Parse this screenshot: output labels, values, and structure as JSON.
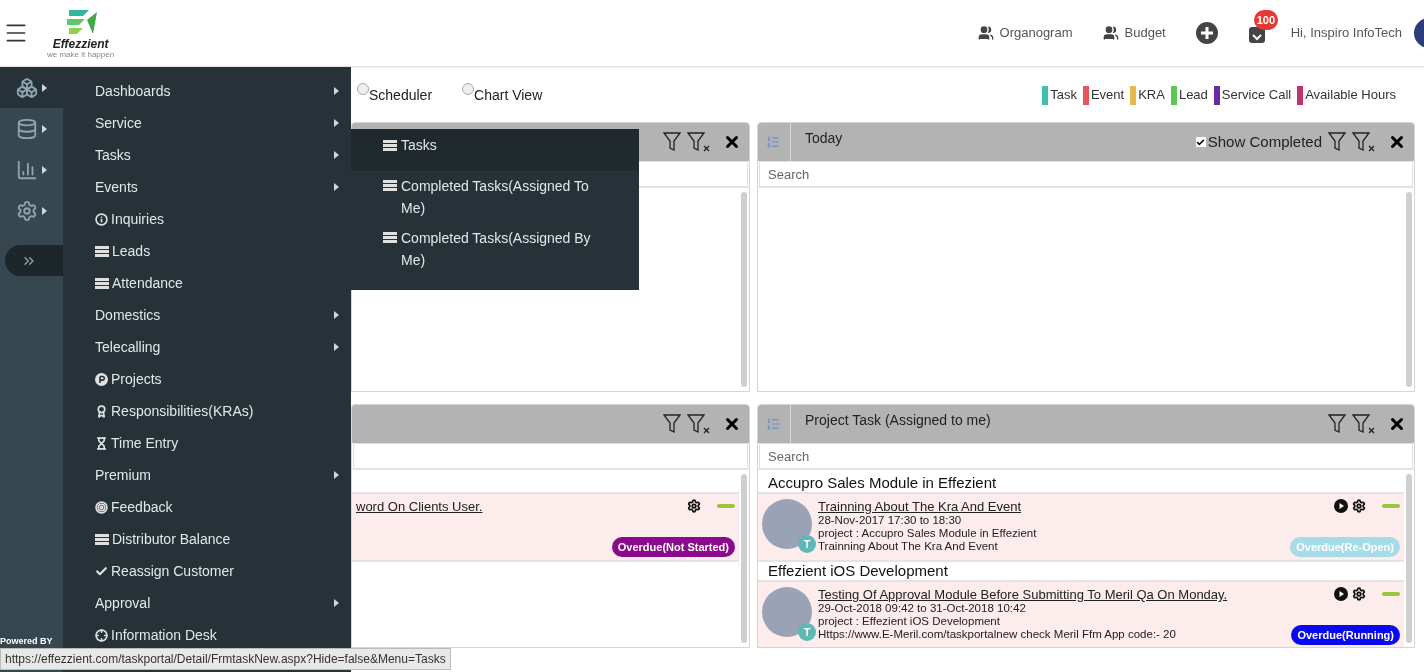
{
  "header": {
    "logo": {
      "name": "Effezzient",
      "tagline": "we make it happen"
    },
    "links": [
      {
        "label": "Organogram"
      },
      {
        "label": "Budget"
      }
    ],
    "notifications": {
      "count": "100"
    },
    "greeting": "Hi, Inspiro InfoTech"
  },
  "rail": {
    "items": [
      {
        "kind": "boxes",
        "selected": true
      },
      {
        "kind": "database",
        "selected": false
      },
      {
        "kind": "chart",
        "selected": false
      },
      {
        "kind": "settings",
        "selected": false
      }
    ],
    "expanded": false,
    "footer": "Powered BY"
  },
  "menu": {
    "items": [
      {
        "label": "Dashboards",
        "kind": "submenu"
      },
      {
        "label": "Service",
        "kind": "submenu"
      },
      {
        "label": "Tasks",
        "kind": "submenu"
      },
      {
        "label": "Events",
        "kind": "submenu"
      },
      {
        "label": "Inquiries",
        "kind": "info"
      },
      {
        "label": "Leads",
        "kind": "list"
      },
      {
        "label": "Attendance",
        "kind": "list"
      },
      {
        "label": "Domestics",
        "kind": "submenu"
      },
      {
        "label": "Telecalling",
        "kind": "submenu"
      },
      {
        "label": "Projects",
        "kind": "project"
      },
      {
        "label": "Responsibilities(KRAs)",
        "kind": "award"
      },
      {
        "label": "Time Entry",
        "kind": "hourglass"
      },
      {
        "label": "Premium",
        "kind": "submenu"
      },
      {
        "label": "Feedback",
        "kind": "feedback"
      },
      {
        "label": "Distributor Balance",
        "kind": "list"
      },
      {
        "label": "Reassign Customer",
        "kind": "check"
      },
      {
        "label": "Approval",
        "kind": "submenu"
      },
      {
        "label": "Information Desk",
        "kind": "desk"
      }
    ]
  },
  "submenu": {
    "items": [
      {
        "label": "Tasks",
        "selected": true
      },
      {
        "label": "Completed Tasks(Assigned To Me)",
        "selected": false
      },
      {
        "label": "Completed Tasks(Assigned By Me)",
        "selected": false
      }
    ]
  },
  "view_options": [
    {
      "label": "Scheduler",
      "selected": false
    },
    {
      "label": "Chart View",
      "selected": false
    }
  ],
  "legend": [
    {
      "label": "Task",
      "color": "#3fbfad"
    },
    {
      "label": "Event",
      "color": "#e8545a"
    },
    {
      "label": "KRA",
      "color": "#e8b84a"
    },
    {
      "label": "Lead",
      "color": "#5cc850"
    },
    {
      "label": "Service Call",
      "color": "#6a2ba0"
    },
    {
      "label": "Available Hours",
      "color": "#c2306e"
    }
  ],
  "panels": [
    {
      "kind": "covered"
    },
    {
      "kind": "titled",
      "title": "Today",
      "show_completed": {
        "label": "Show Completed",
        "checked": true
      },
      "search": {
        "placeholder": "Search"
      }
    },
    {
      "kind": "covered",
      "groups": [
        {
          "tasks": [
            {
              "title": "word On Clients User.",
              "playable": false,
              "status": "Overdue(Not Started)",
              "color": "#8b0a8b"
            }
          ]
        }
      ]
    },
    {
      "kind": "titled",
      "title": "Project Task (Assigned to me)",
      "search": {
        "placeholder": "Search"
      },
      "groups": [
        {
          "name": "Accupro Sales Module in Effezient",
          "tasks": [
            {
              "title": "Trainning About The Kra And Event",
              "time": "28-Nov-2017 17:30 to 18:30",
              "project": "project : Accupro Sales Module in Effezient",
              "description": "Trainning About The Kra And Event",
              "badge": "T",
              "playable": true,
              "status": "Overdue(Re-Open)",
              "color": "#a6dce8"
            }
          ]
        },
        {
          "name": "Effezient iOS Development",
          "tasks": [
            {
              "title": "Testing Of Approval Module Before Submitting To Meril Qa On Monday.",
              "time": "29-Oct-2018 09:42 to 31-Oct-2018 10:42",
              "project": "project : Effezient iOS Development",
              "description": "Https://www.E-Meril.com/taskportalnew check Meril Ffm App code:- 20",
              "badge": "T",
              "playable": true,
              "status": "Overdue(Running)",
              "color": "#0a0af0"
            }
          ]
        }
      ]
    }
  ],
  "status_url": "https://effezzient.com/taskportal/Detail/FrmtaskNew.aspx?Hide=false&Menu=Tasks"
}
